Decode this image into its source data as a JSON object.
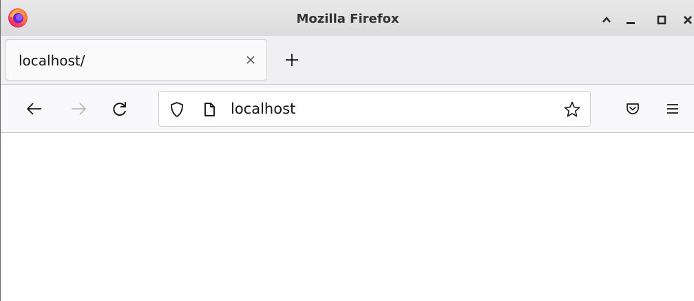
{
  "window": {
    "title": "Mozilla Firefox",
    "icon": "firefox-logo"
  },
  "window_controls": {
    "icons": [
      "caret-up-icon",
      "minimize-icon",
      "maximize-icon",
      "close-icon"
    ]
  },
  "tabs": [
    {
      "label": "localhost/",
      "active": true,
      "close_icon": "close-icon"
    }
  ],
  "new_tab": {
    "icon": "plus-icon"
  },
  "navbar": {
    "back_icon": "arrow-left-icon",
    "forward_icon": "arrow-right-icon",
    "forward_enabled": false,
    "reload_icon": "reload-icon",
    "pocket_icon": "pocket-icon",
    "menu_icon": "hamburger-menu-icon"
  },
  "urlbar": {
    "value": "localhost",
    "shield_icon": "shield-icon",
    "page_icon": "page-icon",
    "bookmark_icon": "star-icon"
  },
  "colors": {
    "titlebar": "#e2e2e2",
    "tabstrip": "#f0f0f3",
    "navbar": "#f9f9fb",
    "text": "#15141a",
    "disabled": "#b8b8bd"
  }
}
